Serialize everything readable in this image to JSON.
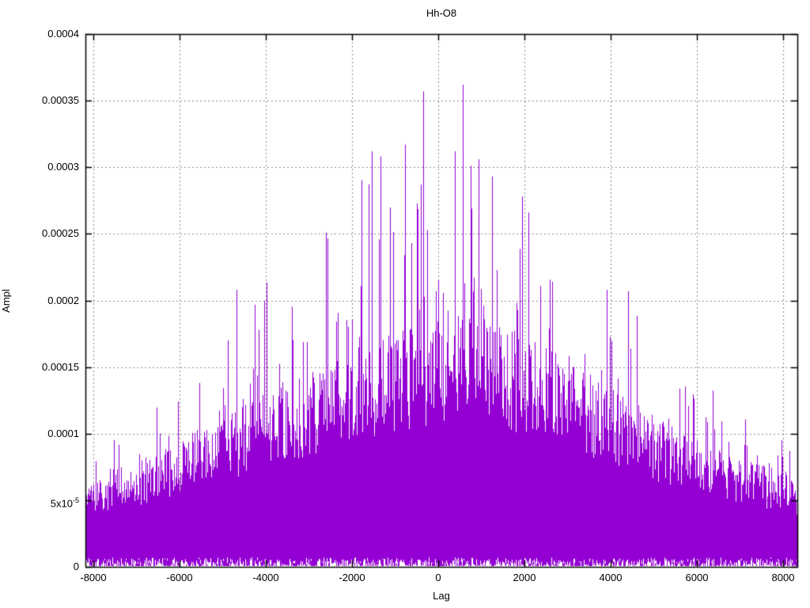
{
  "window": {
    "background": "#ffffff"
  },
  "chart_data": {
    "type": "line",
    "render_style": "dense noisy impulse/line mass",
    "title": "Hh-O8",
    "xlabel": "Lag",
    "ylabel": "Ampl",
    "xlim": [
      -8183,
      8330
    ],
    "ylim": [
      0,
      0.0004
    ],
    "x_ticks": [
      -8000,
      -6000,
      -4000,
      -2000,
      0,
      2000,
      4000,
      6000,
      8000
    ],
    "x_tick_labels": [
      "-8000",
      "-6000",
      "-4000",
      "-2000",
      "0",
      "2000",
      "4000",
      "6000",
      "8000"
    ],
    "y_ticks": [
      0,
      5e-05,
      0.0001,
      0.00015,
      0.0002,
      0.00025,
      0.0003,
      0.00035,
      0.0004
    ],
    "y_tick_labels": [
      {
        "text": "0",
        "exp": ""
      },
      {
        "text": "5x10",
        "exp": "-5"
      },
      {
        "text": "0.0001",
        "exp": ""
      },
      {
        "text": "0.00015",
        "exp": ""
      },
      {
        "text": "0.0002",
        "exp": ""
      },
      {
        "text": "0.00025",
        "exp": ""
      },
      {
        "text": "0.0003",
        "exp": ""
      },
      {
        "text": "0.00035",
        "exp": ""
      },
      {
        "text": "0.0004",
        "exp": ""
      }
    ],
    "grid": {
      "shown": true,
      "color": "#8c8c8c",
      "style": "dotted",
      "position": "behind-data"
    },
    "border_color": "#000000",
    "text_color": "#000000",
    "tics": {
      "mirror": true,
      "direction": "in"
    },
    "series": [
      {
        "name": "Hh-O8",
        "color": "#9400D3",
        "description": "Dense noise-like amplitude vs lag; solid mass with sparse tall spikes, bell-shaped envelope peaking near lag 0"
      }
    ],
    "envelope_dense_top": [
      [
        -8183,
        5e-05
      ],
      [
        -7000,
        6.3e-05
      ],
      [
        -6000,
        7.6e-05
      ],
      [
        -5000,
        8.8e-05
      ],
      [
        -4000,
        0.000103
      ],
      [
        -3000,
        0.000116
      ],
      [
        -2000,
        0.000128
      ],
      [
        -1000,
        0.00014
      ],
      [
        0,
        0.000147
      ],
      [
        1000,
        0.000147
      ],
      [
        2000,
        0.000138
      ],
      [
        3000,
        0.000122
      ],
      [
        4000,
        0.000106
      ],
      [
        5000,
        9e-05
      ],
      [
        6000,
        7.6e-05
      ],
      [
        7000,
        6.6e-05
      ],
      [
        8330,
        5.4e-05
      ]
    ],
    "envelope_spike_max": [
      [
        -8183,
        9e-05
      ],
      [
        -7500,
        0.0001
      ],
      [
        -7000,
        0.00011
      ],
      [
        -6000,
        0.00015
      ],
      [
        -5000,
        0.00016
      ],
      [
        -4500,
        0.00021
      ],
      [
        -3500,
        0.000225
      ],
      [
        -3000,
        0.00024
      ],
      [
        -2500,
        0.00025
      ],
      [
        -2000,
        0.000285
      ],
      [
        -1500,
        0.00031
      ],
      [
        -1000,
        0.000315
      ],
      [
        -500,
        0.00033
      ],
      [
        0,
        0.00032
      ],
      [
        500,
        0.00034
      ],
      [
        1000,
        0.000305
      ],
      [
        1500,
        0.000295
      ],
      [
        2000,
        0.000275
      ],
      [
        2500,
        0.00024
      ],
      [
        3000,
        0.000215
      ],
      [
        3500,
        0.00019
      ],
      [
        4000,
        0.00021
      ],
      [
        4500,
        0.00021
      ],
      [
        5000,
        0.000165
      ],
      [
        5500,
        0.00015
      ],
      [
        6000,
        0.00015
      ],
      [
        6500,
        0.00013
      ],
      [
        7000,
        0.000118
      ],
      [
        7500,
        0.000105
      ],
      [
        8330,
        9.5e-05
      ]
    ],
    "notable_peaks": [
      [
        -4680,
        0.000208
      ],
      [
        -2600,
        0.000251
      ],
      [
        -1540,
        0.000312
      ],
      [
        -770,
        0.000317
      ],
      [
        -349,
        0.000357
      ],
      [
        569,
        0.000362
      ],
      [
        940,
        0.000306
      ],
      [
        1250,
        0.000293
      ],
      [
        1950,
        0.000278
      ],
      [
        2090,
        0.000266
      ],
      [
        3900,
        0.000208
      ],
      [
        4400,
        0.000207
      ]
    ],
    "noise_seed": 1337,
    "spike_probability": 0.3,
    "bottom_spike_probability": 0.38
  }
}
